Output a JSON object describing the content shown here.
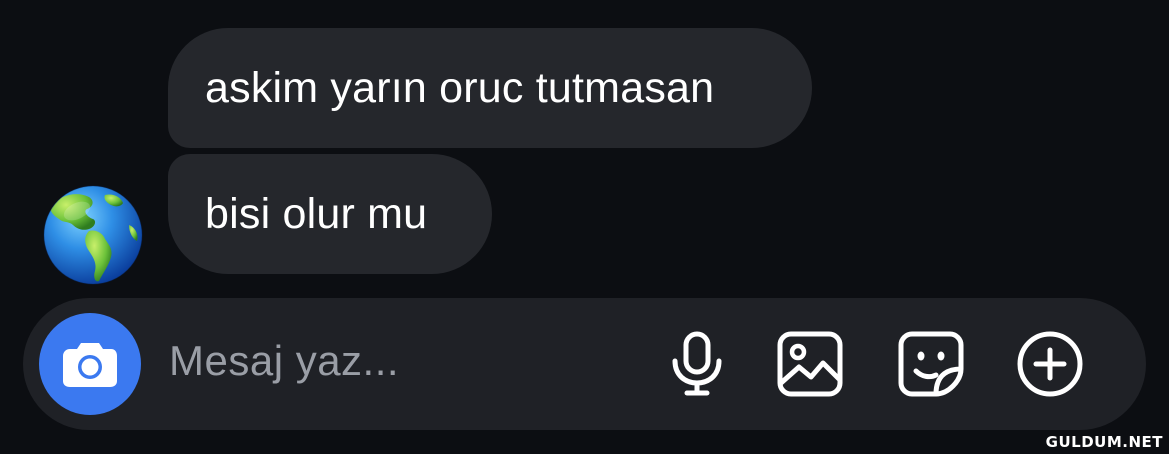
{
  "messages": [
    {
      "text": "askim yarın oruc tutmasan"
    },
    {
      "text": "bisi olur mu"
    }
  ],
  "avatar": {
    "icon": "globe-americas-icon"
  },
  "composer": {
    "placeholder": "Mesaj yaz...",
    "camera_icon": "camera-icon",
    "tools": [
      "microphone-icon",
      "image-icon",
      "sticker-icon",
      "plus-circle-icon"
    ],
    "accent_color": "#3b79f0"
  },
  "watermark": "GULDUM.NET"
}
